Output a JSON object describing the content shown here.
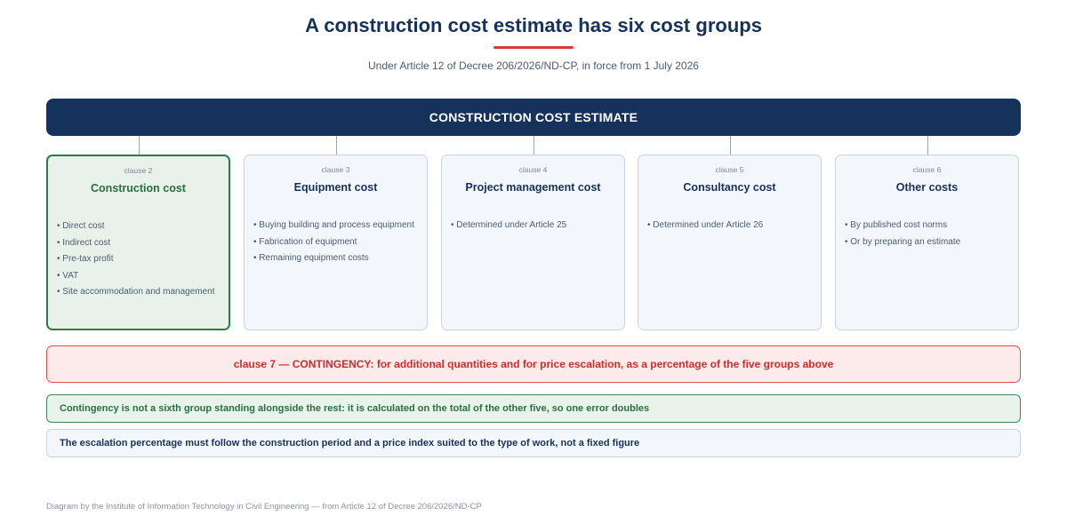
{
  "title": "A construction cost estimate has six cost groups",
  "subtitle": "Under Article 12 of Decree 206/2026/ND-CP, in force from 1 July 2026",
  "banner": "CONSTRUCTION COST ESTIMATE",
  "groups": [
    {
      "clause": "clause 2",
      "title": "Construction cost",
      "items": [
        "Direct cost",
        "Indirect cost",
        "Pre-tax profit",
        "VAT",
        "Site accommodation and management"
      ]
    },
    {
      "clause": "clause 3",
      "title": "Equipment cost",
      "items": [
        "Buying building and process equipment",
        "Fabrication of equipment",
        "Remaining equipment costs"
      ]
    },
    {
      "clause": "clause 4",
      "title": "Project management cost",
      "items": [
        "Determined under Article 25"
      ]
    },
    {
      "clause": "clause 5",
      "title": "Consultancy cost",
      "items": [
        "Determined under Article 26"
      ]
    },
    {
      "clause": "clause 6",
      "title": "Other costs",
      "items": [
        "By published cost norms",
        "Or by preparing an estimate"
      ]
    }
  ],
  "contingency": "clause 7 — CONTINGENCY: for additional quantities and for price escalation, as a percentage of the five groups above",
  "notes": {
    "green": "Contingency is not a sixth group standing alongside the rest: it is calculated on the total of the other five, so one error doubles",
    "blue": "The escalation percentage must follow the construction period and a price index suited to the type of work, not a fixed figure"
  },
  "footer": "Diagram by the Institute of Information Technology in Civil Engineering — from Article 12 of Decree 206/2026/ND-CP",
  "colors": {
    "navy": "#15325c",
    "accent_red": "#d63a3a",
    "green": "#2f7a45",
    "card_bg": "#f3f7fc"
  }
}
